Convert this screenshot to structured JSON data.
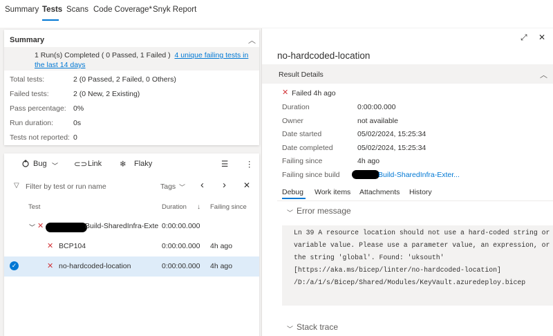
{
  "tabs": [
    "Summary",
    "Tests",
    "Scans",
    "Code Coverage*",
    "Snyk Report"
  ],
  "summary": {
    "title": "Summary",
    "banner_text": "1 Run(s) Completed ( 0 Passed, 1 Failed )",
    "banner_link": "4 unique failing tests in the last 14 days",
    "rows": [
      {
        "label": "Total tests:",
        "value": "2 (0 Passed, 2 Failed, 0 Others)"
      },
      {
        "label": "Failed tests:",
        "value": "2 (0 New, 2 Existing)"
      },
      {
        "label": "Pass percentage:",
        "value": "0%"
      },
      {
        "label": "Run duration:",
        "value": "0s"
      },
      {
        "label": "Tests not reported:",
        "value": "0"
      }
    ]
  },
  "results": {
    "toolbar": {
      "bug": "Bug",
      "link": "Link",
      "flaky": "Flaky"
    },
    "filter_placeholder": "Filter by test or run name",
    "tags_label": "Tags",
    "columns": {
      "test": "Test",
      "duration": "Duration",
      "failing_since": "Failing since"
    },
    "rows": [
      {
        "name": "Build-SharedInfra-Exte",
        "duration": "0:00:00.000",
        "failing": ""
      },
      {
        "name": "BCP104",
        "duration": "0:00:00.000",
        "failing": "4h ago"
      },
      {
        "name": "no-hardcoded-location",
        "duration": "0:00:00.000",
        "failing": "4h ago"
      }
    ]
  },
  "detail": {
    "title": "no-hardcoded-location",
    "result_details_label": "Result Details",
    "status": "Failed 4h ago",
    "fields": [
      {
        "label": "Duration",
        "value": "0:00:00.000"
      },
      {
        "label": "Owner",
        "value": "not available"
      },
      {
        "label": "Date started",
        "value": "05/02/2024, 15:25:34"
      },
      {
        "label": "Date completed",
        "value": "05/02/2024, 15:25:34"
      },
      {
        "label": "Failing since",
        "value": "4h ago"
      },
      {
        "label": "Failing since build",
        "value": "Build-SharedInfra-Exter..."
      }
    ],
    "subtabs": [
      "Debug",
      "Work items",
      "Attachments",
      "History"
    ],
    "error_heading": "Error message",
    "error_lines": [
      "Ln 39 A resource location should not use a hard-coded string or",
      "variable value. Please use a parameter value, an expression, or",
      "the string 'global'. Found: 'uksouth'",
      "[https://aka.ms/bicep/linter/no-hardcoded-location]",
      "/D:/a/1/s/Bicep/Shared/Modules/KeyVault.azuredeploy.bicep"
    ],
    "stack_heading": "Stack trace"
  },
  "colors": {
    "accent": "#0078d4",
    "fail": "#d13438",
    "selected_row": "#deecf9"
  }
}
